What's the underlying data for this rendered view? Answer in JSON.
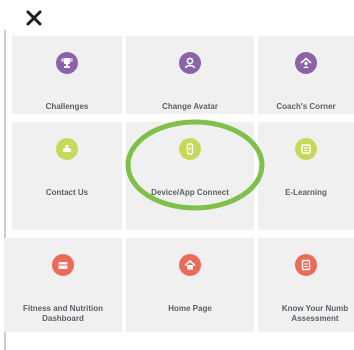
{
  "colors": {
    "purple": "#8a63a8",
    "green": "#c6d95a",
    "red": "#ec6a5a",
    "highlight_ring": "#7ec04a"
  },
  "close": {
    "icon": "close-icon"
  },
  "tiles": [
    {
      "label": "Challenges",
      "icon": "trophy-icon"
    },
    {
      "label": "Change Avatar",
      "icon": "user-icon"
    },
    {
      "label": "Coach's Corner",
      "icon": "coach-icon"
    },
    {
      "label": "Contact Us",
      "icon": "phone-icon"
    },
    {
      "label": "Device/App Connect",
      "icon": "watch-icon"
    },
    {
      "label": "E-Learning",
      "icon": "book-icon"
    },
    {
      "label": "Fitness and Nutrition\nDashboard",
      "icon": "dashboard-icon"
    },
    {
      "label": "Home Page",
      "icon": "home-icon"
    },
    {
      "label": "Know Your Numb\nAssessment",
      "icon": "clipboard-icon"
    }
  ]
}
